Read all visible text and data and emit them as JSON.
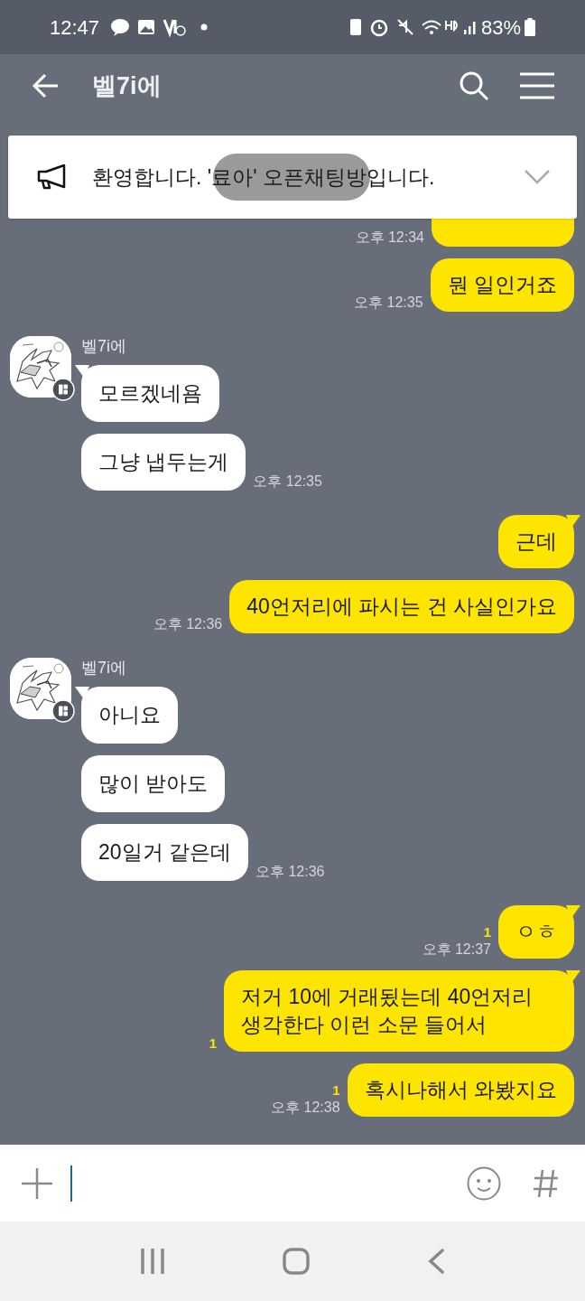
{
  "status_bar": {
    "time": "12:47",
    "battery": "83%"
  },
  "header": {
    "title": "벨7i에"
  },
  "notice": {
    "text": "환영합니다. '료아' 오픈채팅방입니다."
  },
  "groups": [
    {
      "kind": "mine",
      "bubbles": [
        {
          "kind": "clipped",
          "time": "오후 12:34"
        },
        {
          "kind": "text",
          "text": "뭔 일인거죠",
          "tail": false,
          "time": "오후 12:35"
        }
      ]
    },
    {
      "kind": "theirs",
      "sender": "벨7i에",
      "bubbles": [
        {
          "kind": "text",
          "text": "모르겠네욤",
          "tail": true
        },
        {
          "kind": "text",
          "text": "그냥 냅두는게",
          "tail": false,
          "time": "오후 12:35"
        }
      ]
    },
    {
      "kind": "mine",
      "bubbles": [
        {
          "kind": "text",
          "text": "근데",
          "tail": true
        },
        {
          "kind": "text",
          "text": "40언저리에 파시는 건 사실인가요",
          "tail": false,
          "time": "오후 12:36"
        }
      ]
    },
    {
      "kind": "theirs",
      "sender": "벨7i에",
      "bubbles": [
        {
          "kind": "text",
          "text": "아니요",
          "tail": true
        },
        {
          "kind": "text",
          "text": "많이 받아도",
          "tail": false
        },
        {
          "kind": "text",
          "text": "20일거 같은데",
          "tail": false,
          "time": "오후 12:36"
        }
      ]
    },
    {
      "kind": "mine",
      "bubbles": [
        {
          "kind": "text",
          "text": "ㅇㅎ",
          "tail": true,
          "unread": "1",
          "time": "오후 12:37"
        },
        {
          "kind": "text",
          "text": "저거 10에 거래됬는데 40언저리 생각한다 이런 소문 들어서",
          "tail": true,
          "unread": "1"
        },
        {
          "kind": "text",
          "text": "혹시나해서 와봤지요",
          "tail": false,
          "unread": "1",
          "time": "오후 12:38"
        }
      ]
    }
  ]
}
